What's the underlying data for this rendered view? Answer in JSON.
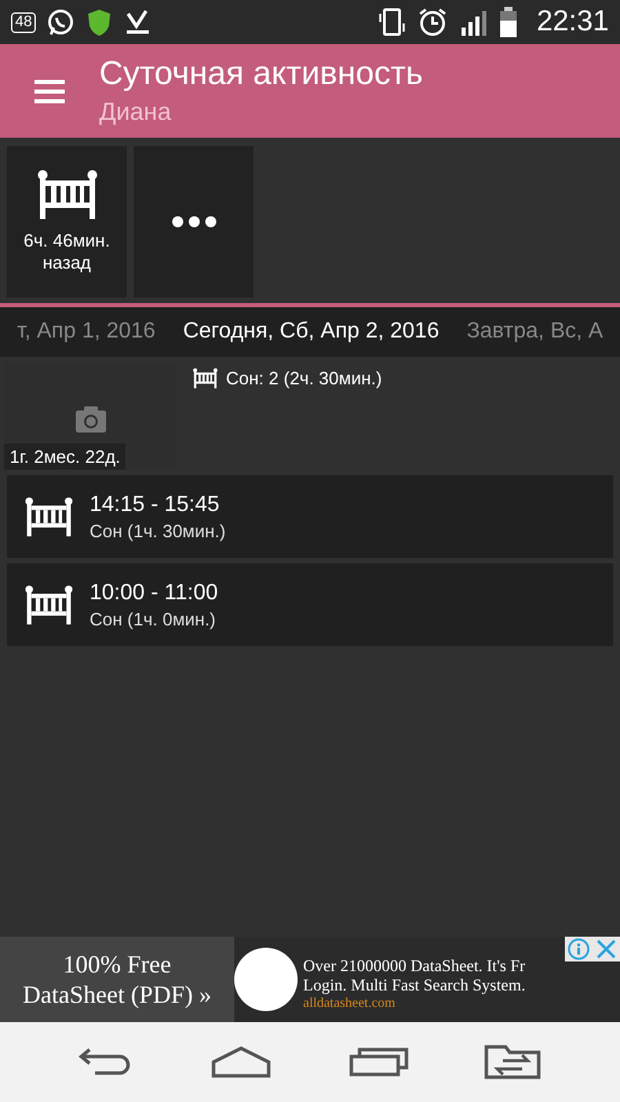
{
  "status_bar": {
    "notification_count": "48",
    "time": "22:31"
  },
  "app_bar": {
    "title": "Суточная активность",
    "subtitle": "Диана"
  },
  "quick_tiles": [
    {
      "kind": "activity",
      "label": "6ч. 46мин. назад"
    },
    {
      "kind": "more"
    }
  ],
  "date_strip": [
    {
      "label": "т, Апр 1, 2016",
      "selected": false
    },
    {
      "label": "Сегодня, Сб, Апр 2, 2016",
      "selected": true
    },
    {
      "label": "Завтра, Вс, А",
      "selected": false
    }
  ],
  "day_summary": {
    "age": "1г. 2мес. 22д.",
    "totals": [
      {
        "label": "Сон: 2 (2ч. 30мин.)"
      }
    ]
  },
  "entries": [
    {
      "time": "14:15 - 15:45",
      "description": "Сон (1ч. 30мин.)"
    },
    {
      "time": "10:00 - 11:00",
      "description": "Сон (1ч. 0мин.)"
    }
  ],
  "ad": {
    "headline": "100% Free DataSheet (PDF) »",
    "text": "Over 21000000 DataSheet. It's Fr",
    "text_2": "Login. Multi Fast Search System.",
    "source": "alldatasheet.com"
  }
}
